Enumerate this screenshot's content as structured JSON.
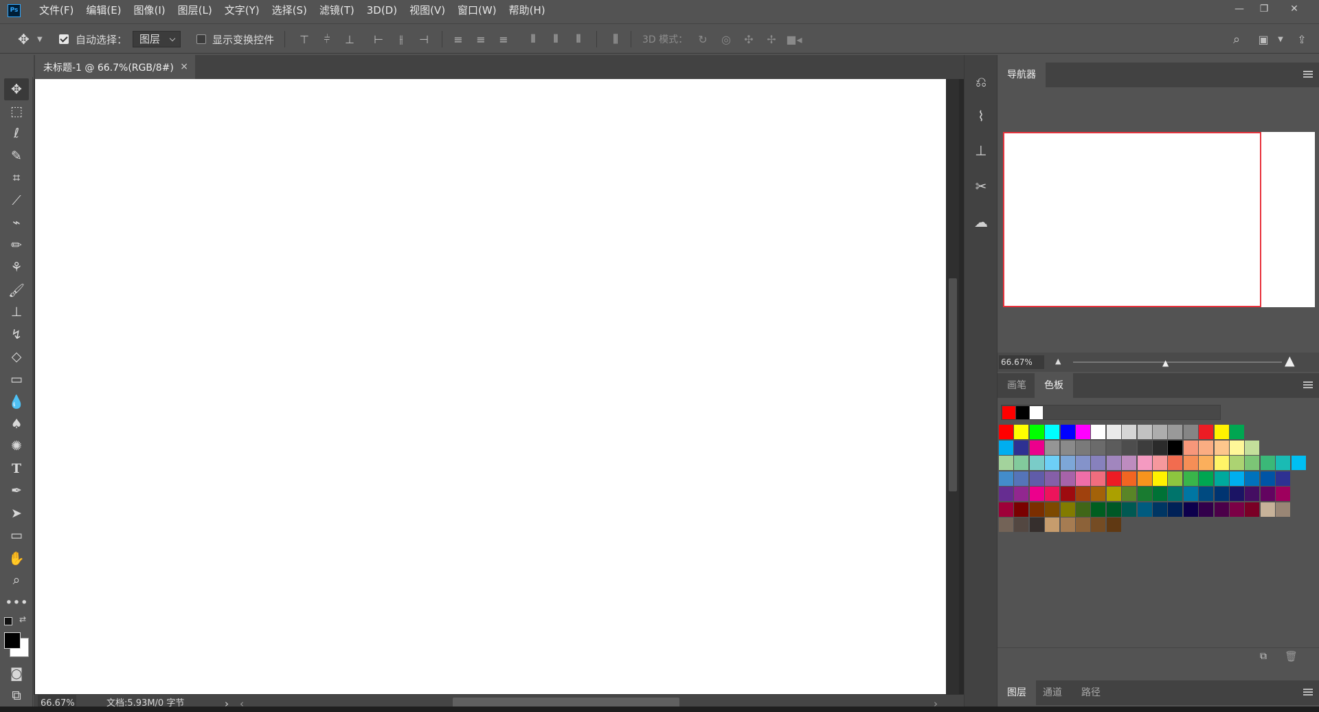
{
  "app": {
    "logo": "Ps"
  },
  "menubar": {
    "items": [
      "文件(F)",
      "编辑(E)",
      "图像(I)",
      "图层(L)",
      "文字(Y)",
      "选择(S)",
      "滤镜(T)",
      "3D(D)",
      "视图(V)",
      "窗口(W)",
      "帮助(H)"
    ]
  },
  "window_controls": {
    "minimize": "—",
    "restore": "❐",
    "close": "✕"
  },
  "options": {
    "auto_select_label": "自动选择：",
    "auto_select_checked": true,
    "auto_select_value": "图层",
    "show_transform_label": "显示变换控件",
    "show_transform_checked": false,
    "mode_3d_label": "3D 模式："
  },
  "document": {
    "tab_title": "未标题-1 @ 66.7%(RGB/8#)",
    "close": "×"
  },
  "status": {
    "zoom": "66.67%",
    "doc_info": "文档:5.93M/0 字节",
    "arrow": "›",
    "left_arrow": "‹",
    "right_arrow": "›"
  },
  "navigator": {
    "tab": "导航器",
    "zoom": "66.67%"
  },
  "swatch_panel": {
    "tabs": [
      "画笔",
      "色板"
    ],
    "active": "色板",
    "recent": [
      "#ff0000",
      "#000000",
      "#ffffff"
    ]
  },
  "layers_panel": {
    "tabs": [
      "图层",
      "通道",
      "路径"
    ],
    "active": "图层"
  },
  "swatches": [
    [
      "#ff0000",
      "#ffff00",
      "#00ff00",
      "#00ffff",
      "#0000ff",
      "#ff00ff",
      "#ffffff",
      "#ebebeb",
      "#d6d6d6",
      "#c2c2c2",
      "#adadad",
      "#999999",
      "#858585",
      "#ed1c24",
      "#fff200",
      "#00a651"
    ],
    [
      "#00aeef",
      "#2e3192",
      "#ec008c",
      "#959595",
      "#8a8a8a",
      "#7a7a7a",
      "#6b6b6b",
      "#5c5c5c",
      "#4d4d4d",
      "#3d3d3d",
      "#2b2b2b",
      "#000000",
      "#f7977a",
      "#fbad82",
      "#fdc68c",
      "#fff799",
      "#c4df9b"
    ],
    [
      "#a3d39c",
      "#82ca9c",
      "#7accc8",
      "#6dcff6",
      "#7da7d8",
      "#8493ca",
      "#8781bd",
      "#a186be",
      "#bd8cbf",
      "#f49ac1",
      "#f6989d",
      "#f26c4f",
      "#f68e56",
      "#fbaf5c",
      "#fff467",
      "#acd372",
      "#7cc576",
      "#3bb878",
      "#1abbb4",
      "#00bff3"
    ],
    [
      "#438ccb",
      "#5574b9",
      "#605ca9",
      "#855fa8",
      "#a763a9",
      "#ef6ea8",
      "#f16d7e",
      "#ed1c24",
      "#f26522",
      "#f7941d",
      "#fff200",
      "#8dc63f",
      "#39b54a",
      "#00a651",
      "#00a99d",
      "#00aeef",
      "#0072bc",
      "#0054a5",
      "#2e3192"
    ],
    [
      "#662d91",
      "#92278f",
      "#ec008c",
      "#ed145b",
      "#9e0b0f",
      "#a0410d",
      "#a36209",
      "#aba000",
      "#598527",
      "#197b30",
      "#007236",
      "#00746b",
      "#0076a3",
      "#004a80",
      "#003471",
      "#1b1464",
      "#440e62",
      "#630460",
      "#9e005d"
    ],
    [
      "#9e0039",
      "#790000",
      "#7b2e00",
      "#7d4900",
      "#827b00",
      "#406618",
      "#005e20",
      "#005826",
      "#005952",
      "#005b7f",
      "#003663",
      "#002157",
      "#0d004c",
      "#32004b",
      "#4b0049",
      "#7b0046",
      "#7a0026",
      "#c7b299",
      "#998675"
    ],
    [
      "#736357",
      "#534741",
      "#362f2d",
      "#c69c6d",
      "#a67c52",
      "#8c6239",
      "#754c24",
      "#603913"
    ]
  ]
}
